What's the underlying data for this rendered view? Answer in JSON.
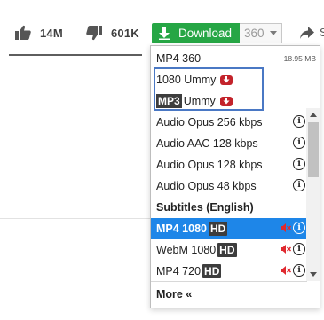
{
  "actions": {
    "like_count": "14M",
    "dislike_count": "601K",
    "download_label": "Download",
    "quality_value": "360",
    "share_label": "S"
  },
  "colors": {
    "download_green": "#26a645",
    "selected_blue": "#1e86e8",
    "highlight_border": "#4a78c4",
    "ummy_red": "#c3232b",
    "mute_red": "#e0292f"
  },
  "menu": {
    "header": {
      "label": "MP4 360",
      "size": "18.95 MB"
    },
    "ummy_items": [
      {
        "label": "1080 Ummy",
        "icon": "ummy-download-icon"
      },
      {
        "badge": "MP3",
        "label": "Ummy",
        "icon": "ummy-download-icon"
      }
    ],
    "audio_items": [
      {
        "label": "Audio Opus 256 kbps"
      },
      {
        "label": "Audio AAC 128 kbps"
      },
      {
        "label": "Audio Opus 128 kbps"
      },
      {
        "label": "Audio Opus 48 kbps"
      }
    ],
    "subtitles_label": "Subtitles (English)",
    "video_items": [
      {
        "label": "MP4 1080",
        "badge": "HD",
        "selected": true
      },
      {
        "label": "WebM 1080",
        "badge": "HD"
      },
      {
        "label": "MP4 720",
        "badge": "HD"
      }
    ],
    "more_label": "More «"
  }
}
